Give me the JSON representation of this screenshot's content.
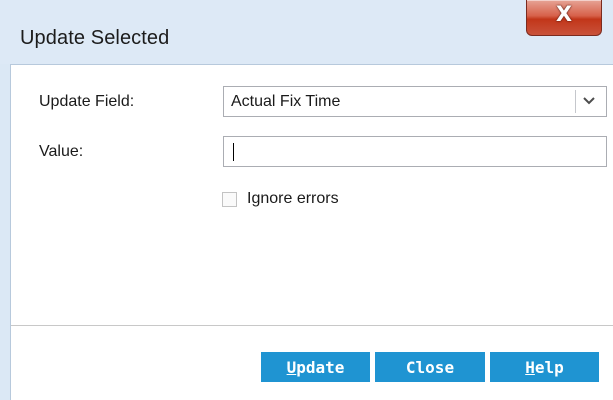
{
  "window": {
    "title": "Update Selected",
    "close_glyph": "X"
  },
  "form": {
    "update_field_label": "Update Field:",
    "update_field_value": "Actual Fix Time",
    "value_label": "Value:",
    "value_text": "",
    "ignore_errors_label": "Ignore errors",
    "ignore_errors_checked": false
  },
  "buttons": {
    "update_accel": "U",
    "update_rest": "pdate",
    "close": "Close",
    "help_accel": "H",
    "help_rest": "elp"
  },
  "colors": {
    "accent": "#1f94d2",
    "title_bg": "#dde9f6",
    "close_red": "#c9523a"
  }
}
